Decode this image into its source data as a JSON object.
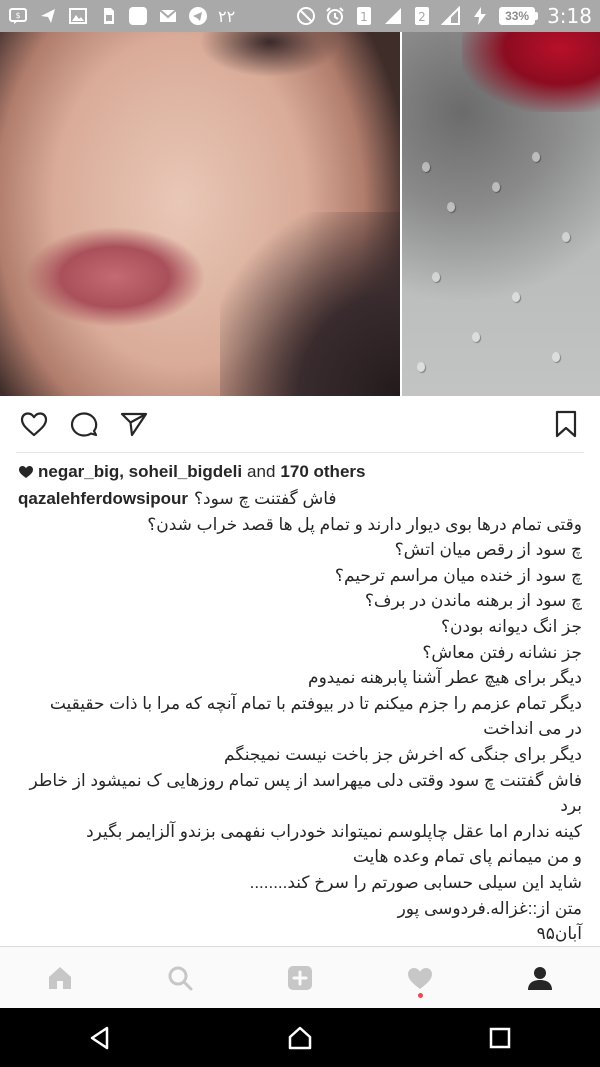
{
  "status_bar": {
    "left_icons": [
      "chat-bubble-icon",
      "send-arrow-icon",
      "gallery-icon",
      "sim-card-icon",
      "whatsapp-icon",
      "email-icon",
      "telegram-icon"
    ],
    "notification_count": "۲۲",
    "sim1_label": "1",
    "sim2_label": "2",
    "battery_percent": "33%",
    "time": "3:18"
  },
  "post": {
    "image_colors": {
      "skin": "#d9ab98",
      "lips": "#b0525c",
      "roses": "#b8102a",
      "glass": "#b6b8b8"
    }
  },
  "likes": {
    "users": "negar_big, soheil_bigdeli",
    "and_text": "and",
    "others": "170 others"
  },
  "caption": {
    "username": "qazalehferdowsipour",
    "title": "فاش گفتنت چ سود؟",
    "lines": [
      "وقتی تمام درها بوی دیوار دارند و تمام پل ها قصد خراب شدن؟",
      "چ سود از رقص میان اتش؟",
      "چ سود از خنده میان مراسم ترحیم؟",
      "چ سود از برهنه ماندن در برف؟",
      "جز انگ دیوانه بودن؟",
      "جز نشانه رفتن معاش؟",
      "دیگر برای هیچ عطر آشنا پابرهنه نمیدوم",
      "دیگر تمام عزمم را جزم میکنم تا در بیوفتم با تمام آنچه که مرا با ذات حقیقیت",
      "در می انداخت",
      "دیگر برای جنگی که اخرش جز باخت نیست نمیجنگم",
      "فاش گفتنت چ سود وقتی دلی میهراسد از پس تمام روزهایی ک نمیشود از خاطر",
      "برد",
      "کینه ندارم اما عقل چاپلوسم نمیتواند خودراب نفهمی بزندو آلزایمر بگیرد",
      "و من میمانم پای تمام وعده هایت",
      "شاید این سیلی حسابی صورتم را سرخ کند........",
      "متن از::غزاله.فردوسی پور",
      "آبان۹۵"
    ]
  },
  "bottom_nav": {
    "items": [
      "home-icon",
      "search-icon",
      "add-post-icon",
      "activity-heart-icon",
      "profile-icon"
    ],
    "accent": "#ed4956"
  },
  "system_nav": {
    "items": [
      "back-triangle-icon",
      "home-circle-icon",
      "recents-square-icon"
    ]
  }
}
